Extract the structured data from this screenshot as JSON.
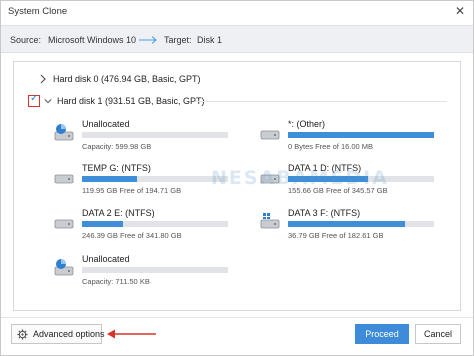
{
  "window": {
    "title": "System Clone"
  },
  "clone": {
    "source_label": "Source:",
    "source_value": "Microsoft Windows 10",
    "target_label": "Target:",
    "target_value": "Disk 1"
  },
  "disks": [
    {
      "label": "Hard disk 0 (476.94 GB, Basic, GPT)",
      "expanded": false,
      "checked": false
    },
    {
      "label": "Hard disk 1 (931.51 GB, Basic, GPT)",
      "expanded": true,
      "checked": true
    }
  ],
  "partitions": [
    {
      "name": "Unallocated",
      "info": "Capacity: 599.98 GB",
      "fill": 0.0,
      "icon": "unallocated-disk-icon"
    },
    {
      "name": "*: (Other)",
      "info": "0 Bytes Free of 16.00 MB",
      "fill": 1.0,
      "icon": "drive-icon"
    },
    {
      "name": "TEMP G: (NTFS)",
      "info": "119.95 GB Free of 194.71 GB",
      "fill": 0.38,
      "icon": "drive-icon"
    },
    {
      "name": "DATA 1 D: (NTFS)",
      "info": "155.66 GB Free of 345.57 GB",
      "fill": 0.55,
      "icon": "drive-icon"
    },
    {
      "name": "DATA 2 E: (NTFS)",
      "info": "246.39 GB Free of 341.80 GB",
      "fill": 0.28,
      "icon": "drive-icon"
    },
    {
      "name": "DATA 3 F: (NTFS)",
      "info": "36.79 GB Free of 182.61 GB",
      "fill": 0.8,
      "icon": "windows-drive-icon"
    },
    {
      "name": "Unallocated",
      "info": "Capacity: 711.50 KB",
      "fill": 0.0,
      "icon": "unallocated-disk-icon"
    }
  ],
  "watermark": "NESABAMEDIA",
  "footer": {
    "advanced_label": "Advanced options",
    "proceed_label": "Proceed",
    "cancel_label": "Cancel"
  },
  "colors": {
    "accent": "#3d8bd9",
    "bar_fill": "#3f8fd8",
    "bar_track": "#e1e3e6",
    "highlight": "#d9322c"
  }
}
